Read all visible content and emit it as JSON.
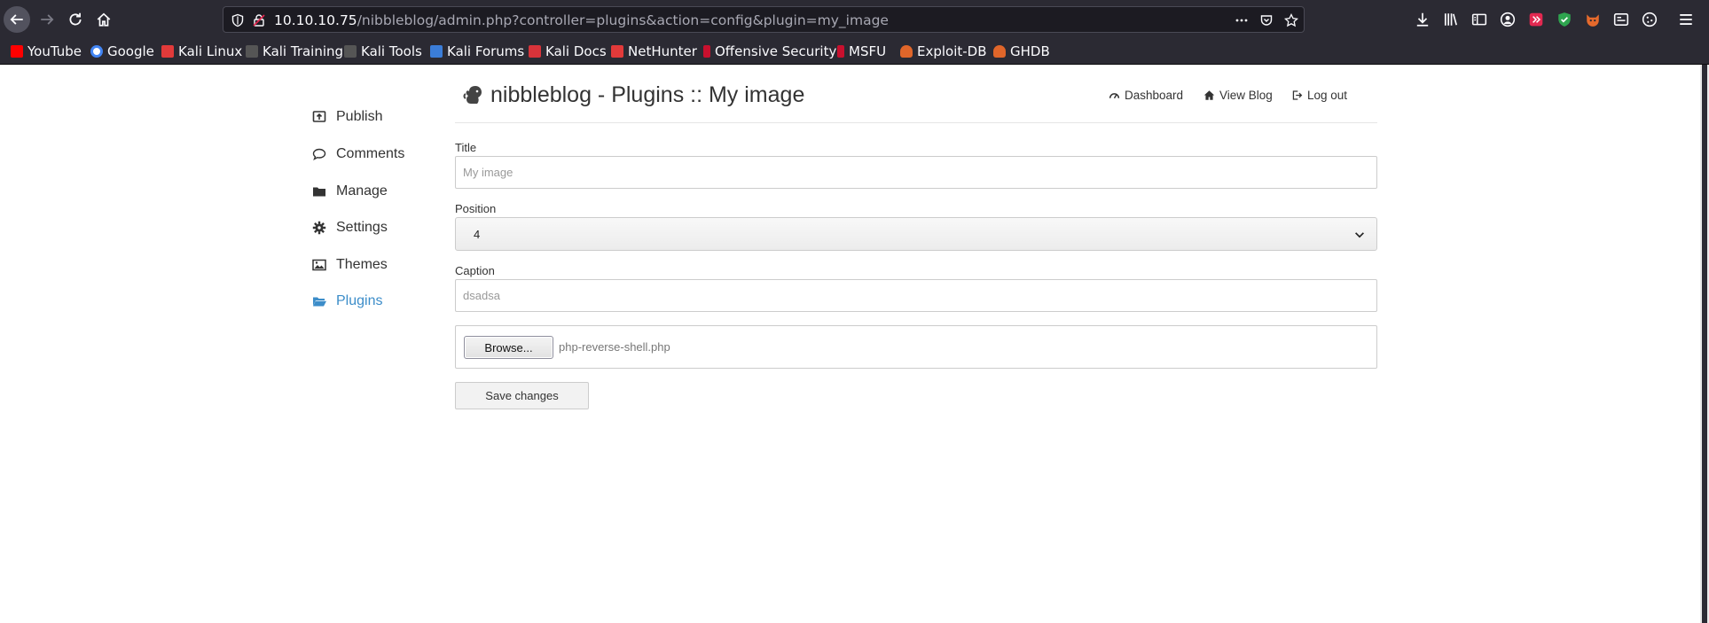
{
  "browser": {
    "url_host": "10.10.10.75",
    "url_path": "/nibbleblog/admin.php?controller=plugins&action=config&plugin=my_image",
    "bookmarks": [
      {
        "label": "YouTube",
        "icon": "youtube-icon",
        "color": "#ff0000"
      },
      {
        "label": "Google",
        "icon": "google-icon",
        "color": "#ffffff"
      },
      {
        "label": "Kali Linux",
        "icon": "kali-linux-icon",
        "color": "#e23a3a"
      },
      {
        "label": "Kali Training",
        "icon": "kali-training-icon",
        "color": "#cccccc"
      },
      {
        "label": "Kali Tools",
        "icon": "kali-tools-icon",
        "color": "#cccccc"
      },
      {
        "label": "Kali Forums",
        "icon": "kali-forums-icon",
        "color": "#3b7dd8"
      },
      {
        "label": "Kali Docs",
        "icon": "kali-docs-icon",
        "color": "#d8333a"
      },
      {
        "label": "NetHunter",
        "icon": "nethunter-icon",
        "color": "#e23a3a"
      },
      {
        "label": "Offensive Security",
        "icon": "offensive-security-icon",
        "color": "#c8102e"
      },
      {
        "label": "MSFU",
        "icon": "msfu-icon",
        "color": "#c8102e"
      },
      {
        "label": "Exploit-DB",
        "icon": "exploit-db-icon",
        "color": "#e0662a"
      },
      {
        "label": "GHDB",
        "icon": "ghdb-icon",
        "color": "#e0662a"
      }
    ]
  },
  "sidebar": {
    "items": [
      {
        "label": "Publish",
        "icon": "publish-icon"
      },
      {
        "label": "Comments",
        "icon": "comments-icon"
      },
      {
        "label": "Manage",
        "icon": "folder-icon"
      },
      {
        "label": "Settings",
        "icon": "gear-icon"
      },
      {
        "label": "Themes",
        "icon": "image-icon"
      },
      {
        "label": "Plugins",
        "icon": "folder-open-icon",
        "active": true
      }
    ]
  },
  "header": {
    "title": "nibbleblog - Plugins :: My image",
    "links": [
      {
        "label": "Dashboard",
        "icon": "dashboard-icon"
      },
      {
        "label": "View Blog",
        "icon": "home-icon"
      },
      {
        "label": "Log out",
        "icon": "logout-icon"
      }
    ]
  },
  "form": {
    "title_label": "Title",
    "title_placeholder": "My image",
    "position_label": "Position",
    "position_value": "4",
    "caption_label": "Caption",
    "caption_value": "dsadsa",
    "browse_label": "Browse...",
    "file_name": "php-reverse-shell.php",
    "save_label": "Save changes"
  },
  "colors": {
    "accent": "#3c8dc9",
    "chrome": "#2b2a33"
  }
}
